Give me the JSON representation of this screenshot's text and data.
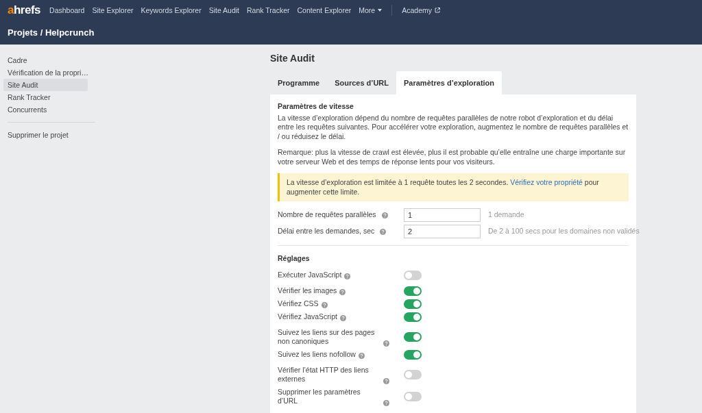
{
  "nav": {
    "logo": "ahrefs",
    "items": [
      {
        "label": "Dashboard",
        "kind": "link"
      },
      {
        "label": "Site Explorer",
        "kind": "link"
      },
      {
        "label": "Keywords Explorer",
        "kind": "link"
      },
      {
        "label": "Site Audit",
        "kind": "link"
      },
      {
        "label": "Rank Tracker",
        "kind": "link"
      },
      {
        "label": "Content Explorer",
        "kind": "link"
      },
      {
        "label": "More",
        "kind": "dropdown"
      },
      {
        "label": "Academy",
        "kind": "external"
      }
    ]
  },
  "breadcrumb": "Projets / Helpcrunch",
  "sidebar": {
    "items": [
      {
        "label": "Cadre",
        "selected": false
      },
      {
        "label": "Vérification de la propri…",
        "selected": false
      },
      {
        "label": "Site Audit",
        "selected": true
      },
      {
        "label": "Rank Tracker",
        "selected": false
      },
      {
        "label": "Concurrents",
        "selected": false
      }
    ],
    "footer_item": "Supprimer le projet"
  },
  "page_title": "Site Audit",
  "tabs": [
    {
      "label": "Programme",
      "selected": false
    },
    {
      "label": "Sources d’URL",
      "selected": false
    },
    {
      "label": "Paramètres d’exploration",
      "selected": true
    }
  ],
  "speed": {
    "heading": "Paramètres de vitesse",
    "paragraphs": [
      "La vitesse d’exploration dépend du nombre de requêtes parallèles de notre robot d’exploration et du délai entre les requêtes suivantes. Pour accélérer votre exploration, augmentez le nombre de requêtes parallèles et / ou réduisez le délai.",
      "Remarque: plus la vitesse de crawl est élevée, plus il est probable qu’elle entraîne une charge importante sur votre serveur Web et des temps de réponse lents pour vos visiteurs."
    ],
    "notice": {
      "before": "La vitesse d’exploration est limitée à 1 requête toutes les 2 secondes.",
      "link": "Vérifiez votre propriété",
      "after": "pour augmenter cette limite."
    },
    "fields": [
      {
        "label": "Nombre de requêtes parallèles",
        "value": "1",
        "hint": "1 demande"
      },
      {
        "label": "Délai entre les demandes, sec",
        "value": "2",
        "hint": "De 2 à 100 secs pour les domaines non validés"
      }
    ]
  },
  "settings": {
    "heading": "Réglages",
    "groups": [
      {
        "items": [
          {
            "label": "Exécuter JavaScript",
            "on": false
          }
        ]
      },
      {
        "items": [
          {
            "label": "Vérifier les images",
            "on": true
          },
          {
            "label": "Vérifiez CSS",
            "on": true
          },
          {
            "label": "Vérifiez JavaScript",
            "on": true
          }
        ]
      },
      {
        "items": [
          {
            "label": "Suivez les liens sur des pages non canoniques",
            "on": true
          },
          {
            "label": "Suivez les liens nofollow",
            "on": true
          }
        ]
      },
      {
        "items": [
          {
            "label": "Vérifier l’état HTTP des liens externes",
            "on": false
          },
          {
            "label": "Supprimer les paramètres d’URL",
            "on": false
          }
        ]
      }
    ]
  }
}
